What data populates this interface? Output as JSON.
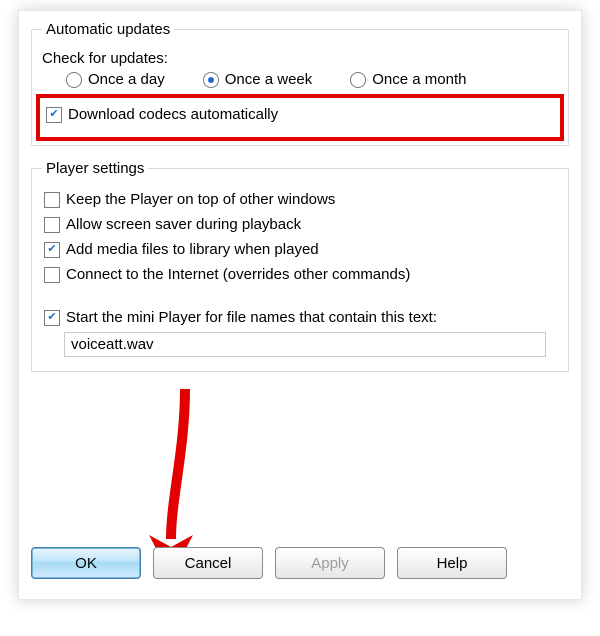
{
  "autoUpdates": {
    "legend": "Automatic updates",
    "checkLabel": "Check for updates:",
    "radios": {
      "day": "Once a day",
      "week": "Once a week",
      "month": "Once a month",
      "selected": "week"
    },
    "downloadCodecs": {
      "label": "Download codecs automatically",
      "checked": true
    }
  },
  "playerSettings": {
    "legend": "Player settings",
    "keepOnTop": {
      "label": "Keep the Player on top of other windows",
      "checked": false
    },
    "screenSaver": {
      "label": "Allow screen saver during playback",
      "checked": false
    },
    "addMedia": {
      "label": "Add media files to library when played",
      "checked": true
    },
    "connectInternet": {
      "label": "Connect to the Internet (overrides other commands)",
      "checked": false
    },
    "miniPlayer": {
      "label": "Start the mini Player for file names that contain this text:",
      "checked": true
    },
    "miniPlayerValue": "voiceatt.wav"
  },
  "buttons": {
    "ok": "OK",
    "cancel": "Cancel",
    "apply": "Apply",
    "help": "Help"
  },
  "annotationColor": "#e20000"
}
